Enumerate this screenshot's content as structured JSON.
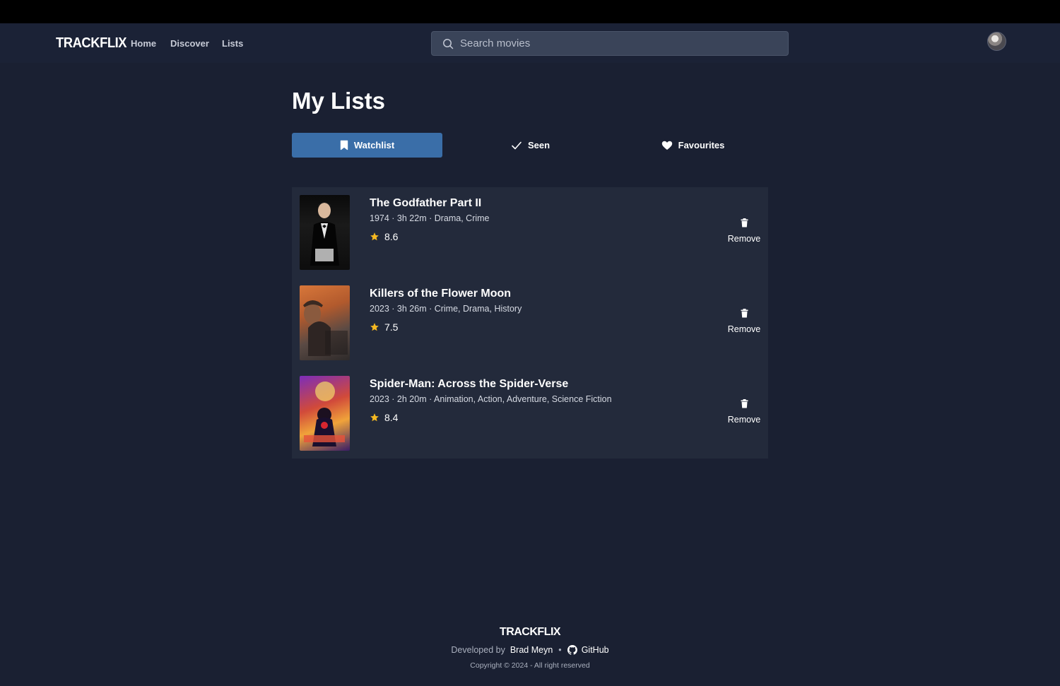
{
  "brand": "TRACKFLIX",
  "nav": {
    "links": [
      "Home",
      "Discover",
      "Lists"
    ]
  },
  "search": {
    "placeholder": "Search movies",
    "value": ""
  },
  "page": {
    "title": "My Lists"
  },
  "tabs": [
    {
      "label": "Watchlist",
      "icon": "bookmark-icon",
      "active": true
    },
    {
      "label": "Seen",
      "icon": "check-icon",
      "active": false
    },
    {
      "label": "Favourites",
      "icon": "heart-icon",
      "active": false
    }
  ],
  "movies": [
    {
      "title": "The Godfather Part II",
      "meta": "1974 · 3h 22m · Drama, Crime",
      "rating": "8.6",
      "remove_label": "Remove"
    },
    {
      "title": "Killers of the Flower Moon",
      "meta": "2023 · 3h 26m · Crime, Drama, History",
      "rating": "7.5",
      "remove_label": "Remove"
    },
    {
      "title": "Spider-Man: Across the Spider-Verse",
      "meta": "2023 · 2h 20m · Animation, Action, Adventure, Science Fiction",
      "rating": "8.4",
      "remove_label": "Remove"
    }
  ],
  "footer": {
    "brand": "TRACKFLIX",
    "developed_by": "Developed by",
    "developer": "Brad Meyn",
    "separator": "•",
    "github": "GitHub",
    "copyright": "Copyright © 2024 - All right reserved"
  },
  "colors": {
    "background": "#1a2032",
    "card": "#232a3b",
    "accent": "#3a6ea8",
    "star": "#f5b921"
  }
}
